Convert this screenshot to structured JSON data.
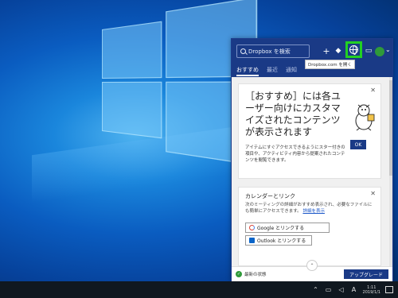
{
  "dropbox": {
    "search_placeholder": "Dropbox を検索",
    "tooltip": "Dropbox.com を開く",
    "tabs": [
      {
        "label": "おすすめ",
        "active": true
      },
      {
        "label": "最近",
        "active": false
      },
      {
        "label": "通知",
        "active": false
      }
    ],
    "card1": {
      "title": "［おすすめ］には各ユーザー向けにカスタマイズされたコンテンツが表示されます",
      "description": "アイテムにすぐアクセスできるようにスター付きの項目や、アクティビティ内容から提案されたコンテンツを閲覧できます。",
      "ok_label": "OK"
    },
    "card2": {
      "title": "カレンダーとリンク",
      "description": "次のミーティングの詳細がおすすめ表示され、必要なファイルにも簡単にアクセスできます。",
      "link_text": "詳細を表示",
      "google_button": "Google とリンクする",
      "outlook_button": "Outlook とリンクする"
    },
    "footer": {
      "status": "最新の状態",
      "upgrade": "アップグレード"
    }
  },
  "taskbar": {
    "ime": "A",
    "time": "1:11",
    "date": "2019/1/1"
  },
  "colors": {
    "brand": "#1a3a86",
    "highlight": "#22d022",
    "status_ok": "#2f9a3a"
  },
  "icons": [
    "search-icon",
    "plus-icon",
    "layers-icon",
    "globe-icon",
    "folder-icon",
    "avatar",
    "chevron-down-icon",
    "close-icon",
    "check-icon",
    "google-icon",
    "outlook-icon"
  ]
}
